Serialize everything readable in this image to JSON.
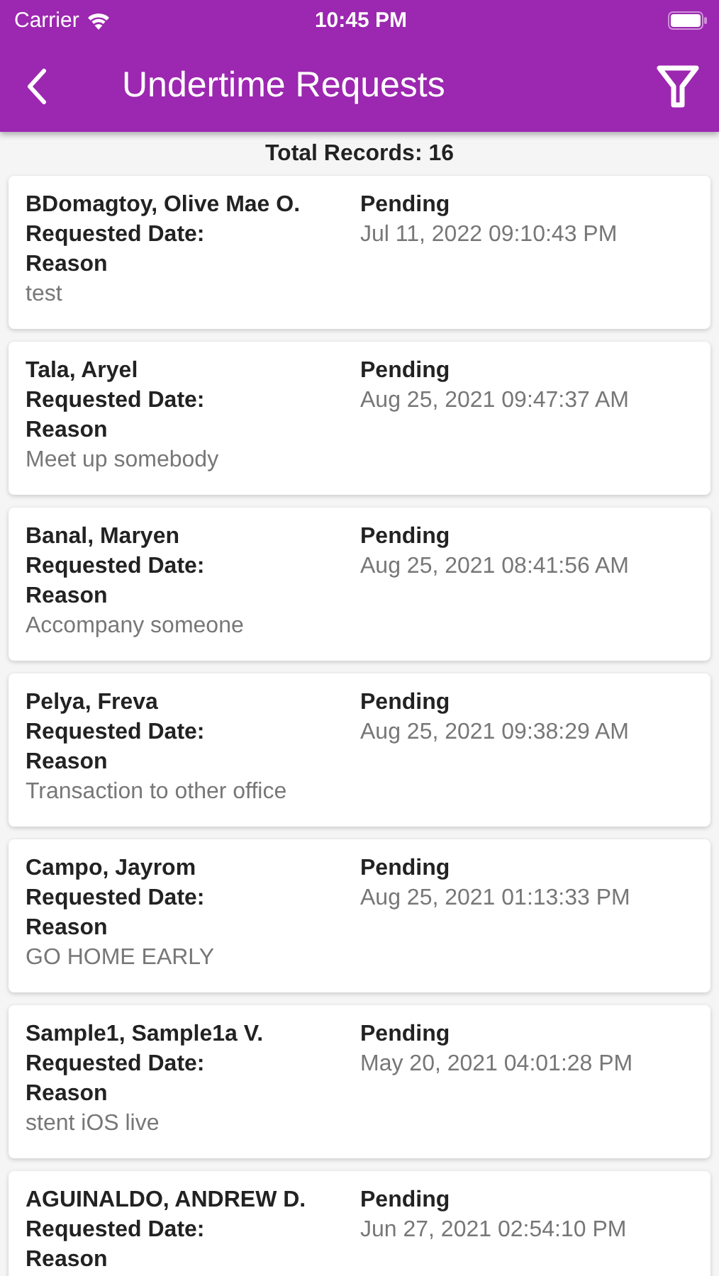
{
  "status_bar": {
    "carrier": "Carrier",
    "time": "10:45 PM"
  },
  "header": {
    "title": "Undertime Requests"
  },
  "total_records": "Total Records: 16",
  "requests": [
    {
      "name": "BDomagtoy, Olive Mae O.",
      "status": "Pending",
      "date_label": "Requested Date:",
      "date": "Jul 11, 2022 09:10:43 PM",
      "reason_label": "Reason",
      "reason": "test"
    },
    {
      "name": "Tala, Aryel",
      "status": "Pending",
      "date_label": "Requested Date:",
      "date": "Aug 25, 2021 09:47:37 AM",
      "reason_label": "Reason",
      "reason": "Meet up somebody"
    },
    {
      "name": "Banal, Maryen",
      "status": "Pending",
      "date_label": "Requested Date:",
      "date": "Aug 25, 2021 08:41:56 AM",
      "reason_label": "Reason",
      "reason": "Accompany someone"
    },
    {
      "name": "Pelya, Freva",
      "status": "Pending",
      "date_label": "Requested Date:",
      "date": "Aug 25, 2021 09:38:29 AM",
      "reason_label": "Reason",
      "reason": "Transaction to other office"
    },
    {
      "name": "Campo, Jayrom",
      "status": "Pending",
      "date_label": "Requested Date:",
      "date": "Aug 25, 2021 01:13:33 PM",
      "reason_label": "Reason",
      "reason": "GO HOME EARLY"
    },
    {
      "name": "Sample1, Sample1a V.",
      "status": "Pending",
      "date_label": "Requested Date:",
      "date": "May 20, 2021 04:01:28 PM",
      "reason_label": "Reason",
      "reason": "stent iOS live"
    },
    {
      "name": "AGUINALDO, ANDREW D.",
      "status": "Pending",
      "date_label": "Requested Date:",
      "date": "Jun 27, 2021 02:54:10 PM",
      "reason_label": "Reason"
    }
  ]
}
